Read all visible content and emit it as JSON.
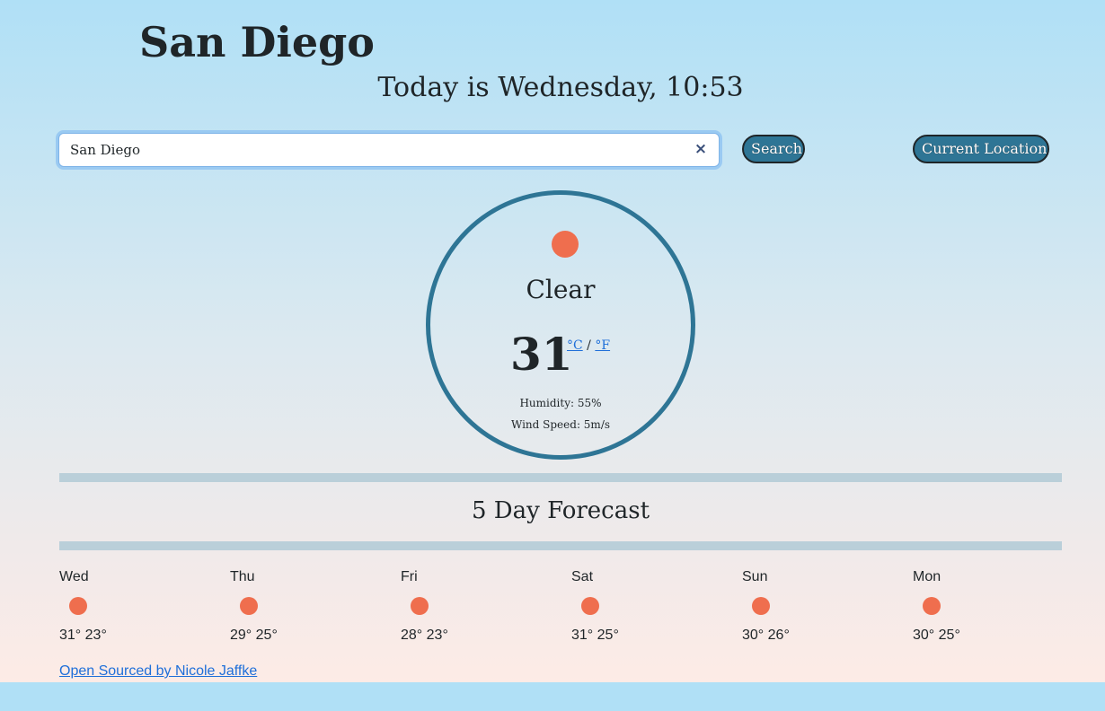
{
  "header": {
    "city": "San Diego",
    "date_line": "Today is Wednesday, 10:53"
  },
  "search": {
    "value": "San Diego",
    "placeholder": "",
    "clear_label": "×",
    "button_label": "Search"
  },
  "location_button_label": "Current Location",
  "current": {
    "icon": "sun-icon",
    "condition": "Clear",
    "temperature": "31",
    "unit_celsius": "°C",
    "unit_separator": "/",
    "unit_fahrenheit": "°F",
    "humidity": "Humidity: 55%",
    "wind": "Wind Speed: 5m/s"
  },
  "forecast": {
    "title": "5 Day Forecast",
    "days": [
      {
        "day": "Wed",
        "icon": "sun-icon",
        "temps": "31° 23°"
      },
      {
        "day": "Thu",
        "icon": "sun-icon",
        "temps": "29° 25°"
      },
      {
        "day": "Fri",
        "icon": "sun-icon",
        "temps": "28° 23°"
      },
      {
        "day": "Sat",
        "icon": "sun-icon",
        "temps": "31° 25°"
      },
      {
        "day": "Sun",
        "icon": "sun-icon",
        "temps": "30° 26°"
      },
      {
        "day": "Mon",
        "icon": "sun-icon",
        "temps": "30° 25°"
      }
    ]
  },
  "footer": {
    "link_text": "Open Sourced by Nicole Jaffke"
  },
  "colors": {
    "accent": "#2e7595",
    "sun": "#ef6e4e",
    "link": "#1f6fd9",
    "divider": "#bacfd9"
  }
}
